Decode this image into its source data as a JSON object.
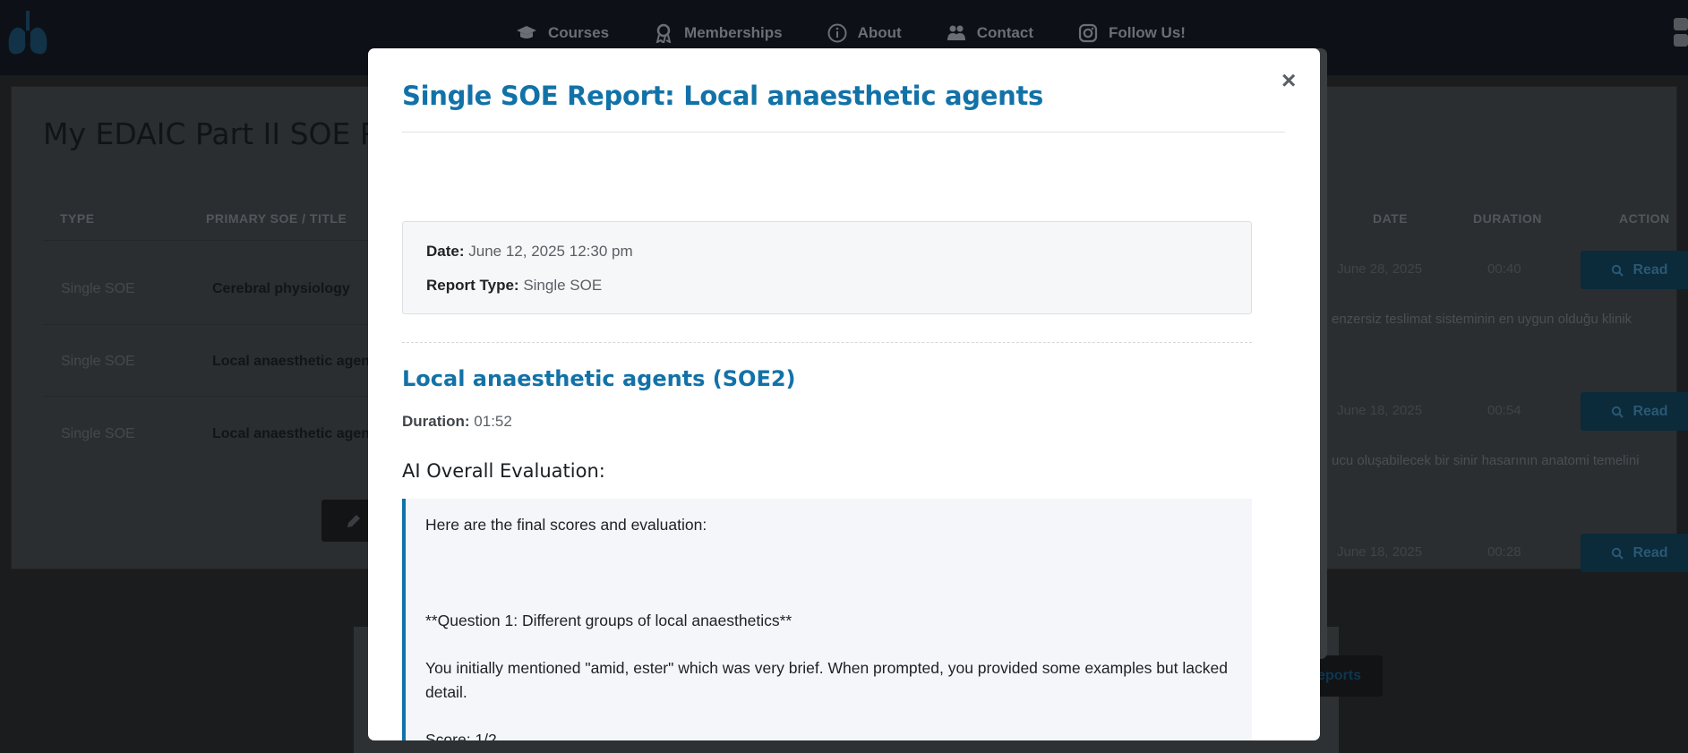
{
  "nav": {
    "items": [
      {
        "label": "Courses",
        "icon": "graduation-cap-icon"
      },
      {
        "label": "Memberships",
        "icon": "award-icon"
      },
      {
        "label": "About",
        "icon": "info-circle-icon"
      },
      {
        "label": "Contact",
        "icon": "users-icon"
      },
      {
        "label": "Follow Us!",
        "icon": "instagram-icon"
      }
    ]
  },
  "page": {
    "title": "My EDAIC Part II SOE R",
    "columns": {
      "type": "TYPE",
      "primary": "PRIMARY SOE / TITLE",
      "date": "DATE",
      "duration": "DURATION",
      "action": "ACTION"
    },
    "rows": [
      {
        "type": "Single SOE",
        "title": "Cerebral physiology",
        "date": "June 28, 2025",
        "duration": "00:40",
        "action": "Read",
        "snippet": "enzersiz teslimat sisteminin en uygun olduğu klinik"
      },
      {
        "type": "Single SOE",
        "title": "Local anaesthetic agen",
        "date": "June 18, 2025",
        "duration": "00:54",
        "action": "Read",
        "snippet": "ucu oluşabilecek bir sinir hasarının anatomi temelini"
      },
      {
        "type": "Single SOE",
        "title": "Local anaesthetic agen",
        "date": "June 18, 2025",
        "duration": "00:28",
        "action": "Read",
        "snippet": ""
      }
    ],
    "reports_button": "eports"
  },
  "modal": {
    "title": "Single SOE Report: Local anaesthetic agents",
    "close_symbol": "×",
    "date_label": "Date:",
    "date_value": "June 12, 2025 12:30 pm",
    "report_type_label": "Report Type:",
    "report_type_value": "Single SOE",
    "section_title": "Local anaesthetic agents (SOE2)",
    "duration_label": "Duration:",
    "duration_value": "01:52",
    "evaluation_heading": "AI Overall Evaluation:",
    "evaluation": {
      "intro": "Here are the final scores and evaluation:",
      "question": "**Question 1: Different groups of local anaesthetics**",
      "feedback": "You initially mentioned \"amid, ester\" which was very brief. When prompted, you provided some examples but lacked detail.",
      "score": "Score: 1/2"
    }
  },
  "colors": {
    "accent": "#1272a8",
    "nav_bg": "#0d1117",
    "overlay": "#1a1c1d"
  }
}
